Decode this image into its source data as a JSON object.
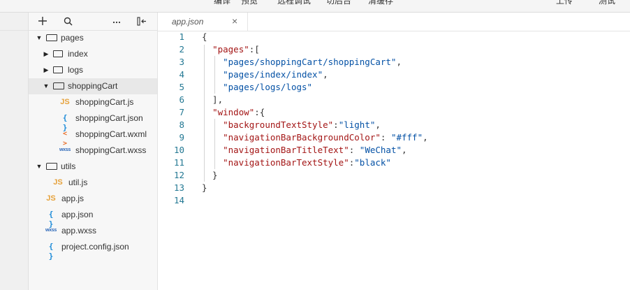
{
  "toolbar": {
    "items": [
      "编译",
      "预览",
      "远程调试",
      "切后台",
      "清缓存"
    ],
    "right_items": [
      "上传",
      "测试"
    ]
  },
  "explorer": {
    "icons": {
      "add": "plus-icon",
      "search": "search-icon",
      "more": "more-icon",
      "collapse": "collapse-panel-icon"
    },
    "tree": [
      {
        "label": "pages",
        "type": "folder",
        "state": "open",
        "indent": 0
      },
      {
        "label": "index",
        "type": "folder",
        "state": "closed",
        "indent": 1
      },
      {
        "label": "logs",
        "type": "folder",
        "state": "closed",
        "indent": 1
      },
      {
        "label": "shoppingCart",
        "type": "folder",
        "state": "open",
        "indent": 1,
        "selected": true
      },
      {
        "label": "shoppingCart.js",
        "type": "js",
        "indent": 2
      },
      {
        "label": "shoppingCart.json",
        "type": "json",
        "indent": 2
      },
      {
        "label": "shoppingCart.wxml",
        "type": "wxml",
        "indent": 2
      },
      {
        "label": "shoppingCart.wxss",
        "type": "wxss",
        "indent": 2
      },
      {
        "label": "utils",
        "type": "folder",
        "state": "open",
        "indent": 0
      },
      {
        "label": "util.js",
        "type": "js",
        "indent": 1
      },
      {
        "label": "app.js",
        "type": "js",
        "indent": 0
      },
      {
        "label": "app.json",
        "type": "json",
        "indent": 0
      },
      {
        "label": "app.wxss",
        "type": "wxss",
        "indent": 0
      },
      {
        "label": "project.config.json",
        "type": "json",
        "indent": 0
      }
    ],
    "file_icon_glyphs": {
      "js": "JS",
      "json": "{ }",
      "wxml": "< >",
      "wxss": "wxss"
    }
  },
  "editor": {
    "tab": {
      "label": "app.json",
      "close": "×"
    },
    "lines": [
      [
        [
          "p",
          "{"
        ]
      ],
      [
        [
          "p",
          "  "
        ],
        [
          "k",
          "\"pages\""
        ],
        [
          "p",
          ":["
        ]
      ],
      [
        [
          "p",
          "    "
        ],
        [
          "s",
          "\"pages/shoppingCart/shoppingCart\""
        ],
        [
          "p",
          ","
        ]
      ],
      [
        [
          "p",
          "    "
        ],
        [
          "s",
          "\"pages/index/index\""
        ],
        [
          "p",
          ","
        ]
      ],
      [
        [
          "p",
          "    "
        ],
        [
          "s",
          "\"pages/logs/logs\""
        ]
      ],
      [
        [
          "p",
          "  ],"
        ]
      ],
      [
        [
          "p",
          "  "
        ],
        [
          "k",
          "\"window\""
        ],
        [
          "p",
          ":{"
        ]
      ],
      [
        [
          "p",
          "    "
        ],
        [
          "k",
          "\"backgroundTextStyle\""
        ],
        [
          "p",
          ":"
        ],
        [
          "s",
          "\"light\""
        ],
        [
          "p",
          ","
        ]
      ],
      [
        [
          "p",
          "    "
        ],
        [
          "k",
          "\"navigationBarBackgroundColor\""
        ],
        [
          "p",
          ": "
        ],
        [
          "s",
          "\"#fff\""
        ],
        [
          "p",
          ","
        ]
      ],
      [
        [
          "p",
          "    "
        ],
        [
          "k",
          "\"navigationBarTitleText\""
        ],
        [
          "p",
          ": "
        ],
        [
          "s",
          "\"WeChat\""
        ],
        [
          "p",
          ","
        ]
      ],
      [
        [
          "p",
          "    "
        ],
        [
          "k",
          "\"navigationBarTextStyle\""
        ],
        [
          "p",
          ":"
        ],
        [
          "s",
          "\"black\""
        ]
      ],
      [
        [
          "p",
          "  }"
        ]
      ],
      [
        [
          "p",
          "}"
        ]
      ],
      []
    ]
  },
  "colors": {
    "key": "#a31515",
    "string": "#0451a5",
    "line_number": "#237893"
  }
}
